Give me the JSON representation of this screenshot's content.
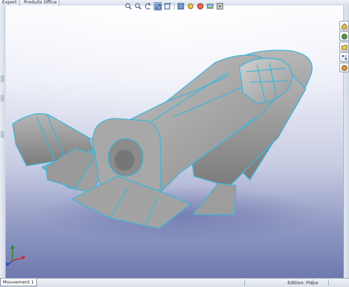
{
  "top_tabs": {
    "export_label": "Export",
    "office_label": "Produits Office"
  },
  "heads_up_toolbar": {
    "icons": [
      "zoom-to-fit-icon",
      "zoom-area-icon",
      "previous-view-icon",
      "section-view-icon",
      "view-orientation-icon",
      "display-style-icon",
      "hide-show-items-icon",
      "edit-appearance-icon",
      "apply-scene-icon",
      "view-settings-icon"
    ],
    "active_icon": "section-view-icon"
  },
  "task_pane": {
    "icons": [
      "home-icon",
      "design-library-icon",
      "file-explorer-icon",
      "view-palette-icon",
      "appearances-icon"
    ]
  },
  "status_bar": {
    "sheet_tab_label": "Mouvement 1",
    "mode_text": "Edition: Pièce"
  },
  "colors": {
    "part_fill": "#a9a9a9",
    "edge_highlight": "#3fb6d8",
    "bg_top": "#fbfbff",
    "bg_bottom": "#6f79ae"
  }
}
